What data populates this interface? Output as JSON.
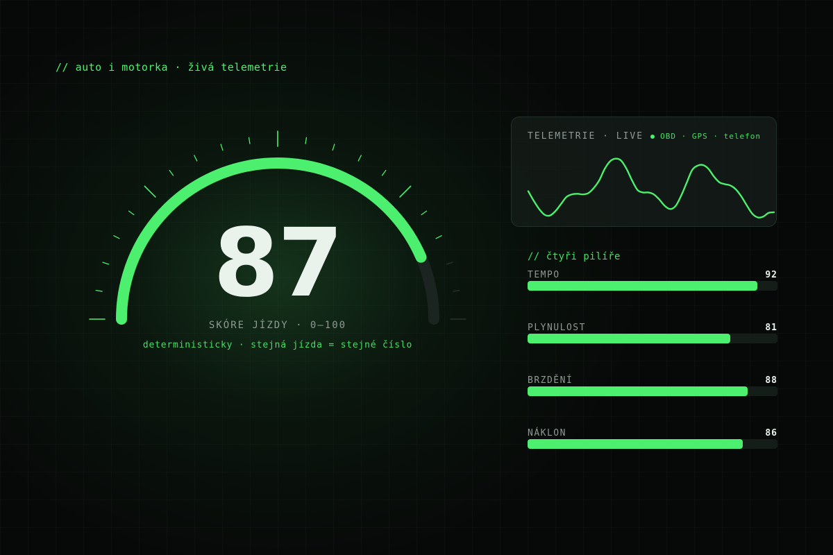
{
  "header": {
    "eyebrow": "// auto i motorka · živá telemetrie"
  },
  "gauge": {
    "score": "87",
    "score_value": 87,
    "min": 0,
    "max": 100,
    "label": "SKÓRE JÍZDY · 0–100",
    "note": "deterministicky · stejná jízda = stejné číslo",
    "accent_color": "#4cf06e"
  },
  "telemetry": {
    "title": "TELEMETRIE · LIVE",
    "sources": "OBD · GPS · telefon",
    "line_color": "#4cf06e"
  },
  "chart_data": {
    "type": "line",
    "x": [
      0,
      1,
      2,
      3,
      4,
      5,
      6,
      7,
      8,
      9,
      10,
      11,
      12,
      13,
      14,
      15,
      16,
      17,
      18,
      19,
      20,
      21,
      22,
      23,
      24,
      25,
      26,
      27,
      28,
      29,
      30,
      31,
      32,
      33,
      34,
      35,
      36,
      37,
      38,
      39,
      40,
      41,
      42,
      43,
      44,
      45,
      46,
      47,
      48,
      49,
      50,
      51,
      52,
      53,
      54,
      55,
      56,
      57,
      58,
      59
    ],
    "values": [
      0.45,
      0.3,
      0.17,
      0.08,
      0.07,
      0.14,
      0.25,
      0.36,
      0.4,
      0.41,
      0.4,
      0.42,
      0.5,
      0.62,
      0.8,
      0.92,
      0.96,
      0.93,
      0.8,
      0.62,
      0.47,
      0.43,
      0.43,
      0.4,
      0.32,
      0.22,
      0.17,
      0.22,
      0.38,
      0.58,
      0.78,
      0.85,
      0.86,
      0.8,
      0.68,
      0.59,
      0.56,
      0.54,
      0.48,
      0.37,
      0.23,
      0.1,
      0.04,
      0.05,
      0.11,
      0.12,
      0.12,
      0.12,
      0.12,
      0.12,
      0.12,
      0.12,
      0.12,
      0.12,
      0.12,
      0.12,
      0.12,
      0.12,
      0.12,
      0.12
    ],
    "visible_points": 46,
    "title": "",
    "xlabel": "",
    "ylabel": "",
    "grid": false,
    "legend": "none"
  },
  "pillars": {
    "heading": "// čtyři pilíře",
    "items": [
      {
        "name": "TEMPO",
        "value": "92",
        "fraction": 0.92
      },
      {
        "name": "PLYNULOST",
        "value": "81",
        "fraction": 0.81
      },
      {
        "name": "BRZDĚNÍ",
        "value": "88",
        "fraction": 0.88
      },
      {
        "name": "NÁKLON",
        "value": "86",
        "fraction": 0.86
      }
    ]
  }
}
